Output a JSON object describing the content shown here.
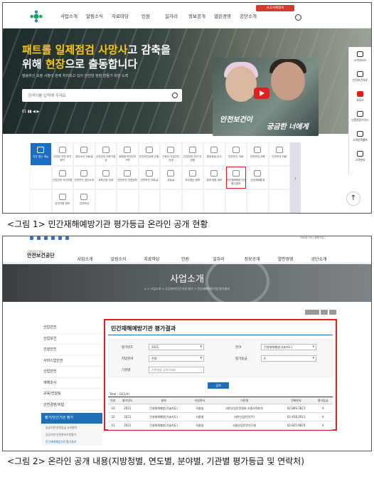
{
  "shot1": {
    "header": {
      "menu": [
        "사업소개",
        "알림소식",
        "자료마당",
        "민원",
        "일자리",
        "정보공개",
        "열린경영",
        "공단소개"
      ],
      "top_button": "사고사례정보"
    },
    "hero": {
      "headline_y1": "패트롤",
      "headline_w1": " 일제점검",
      "headline_y2": " 사망사",
      "headline_w2": "고 감축을",
      "headline_w3": "위해 ",
      "headline_y3": "현장",
      "headline_w4": "으로 출동합니다",
      "sub": "말씀하신 요청 사항이 현재 처리되고 있어 안전한 현장 만들기 위한 노력",
      "search_placeholder": "검색어를 입력해 주세요",
      "pager": "01  ▮▮  ◀ ▶",
      "video_text1": "안전보건이",
      "video_text2": "궁금한 너에게"
    },
    "side_menu": [
      "고객서비스",
      "안전보건자료",
      "유튜브",
      "인증현장가이드",
      "고객만족헬프",
      "고객센터"
    ],
    "grid_items": [
      "자주 찾는 메뉴",
      "사업장 안전 보건평가",
      "공단소식 자료실",
      "산업안전 전문가양성",
      "위험한 작업관리 구역",
      "안전보건교육 신청",
      "근로자 건강진단 안내",
      "산업안전 보건 관련법",
      "현장점검 신고",
      "안전보건 자료",
      "안전보건 교육",
      "안전보건 자료",
      "",
      "산업안전 보건지원",
      "안전보건 공단소개",
      "교육신청 안내",
      "안전보건 관련정보",
      "안전보건 자료실",
      "자료실",
      "자주찾는 정보",
      "유해 위험 정보",
      "민간재해예방기관 평가결과",
      "산업재해통계",
      "",
      "",
      "안전지원 정보",
      "안전보건",
      "",
      "",
      "",
      "",
      "",
      "",
      "",
      "",
      ""
    ],
    "caption": "<그림 1> 민간재해예방기관 평가등급 온라인 공개 현황"
  },
  "shot2": {
    "top_links": "PMS로그인 | 회원가입 |",
    "logo": "안전보건공단",
    "logo_sub": "산업안전보건공단",
    "menu": [
      "사업소개",
      "알림소식",
      "자료마당",
      "민원",
      "일자리",
      "정보공개",
      "열린경영",
      "공단소개"
    ],
    "banner_title": "사업소개",
    "breadcrumb": "⌂  >  사업소개  >  공공분야/민간기관 평가  >  민간재해예방기관 평가결과",
    "lnb": [
      "산업안전",
      "산업보건",
      "건설안전",
      "서비스업안전",
      "산업안전",
      "재해조사",
      "교육/컨설팅",
      "안전경영/위험"
    ],
    "lnb_active": "평가/민간기관 평가",
    "lnb_subs": [
      "공공기관 안전등급 소유평가",
      "공공기관 안전관리수준평가",
      "민간재해예방기관 평가결과"
    ],
    "panel_title": "민간재해예방기관 평가결과",
    "form": {
      "year_label": "평가년도",
      "year_value": "2021",
      "field_label": "분야",
      "field_value": "건설재해예방(기술지도)",
      "region_label": "지방관서",
      "region_value": "전체",
      "grade_label": "평가등급",
      "grade_value": "A",
      "name_label": "기관명",
      "name_placeholder": "기관명을 입력하세요",
      "search_button": "검색"
    },
    "total": "Total : 33(1/4)",
    "table": {
      "headers": [
        "번호",
        "평가년도",
        "분야",
        "지방관서",
        "기관명",
        "전화번호",
        "평가등급"
      ],
      "rows": [
        [
          "33",
          "2021",
          "건설재해예방(기술지도)",
          "서울청",
          "대한산업안전협회 서울지역본부",
          "02-869-7873",
          "A"
        ],
        [
          "32",
          "2021",
          "건설재해예방(기술지도)",
          "서울청",
          "대한산업안전(주)",
          "02-458-2013",
          "A"
        ],
        [
          "31",
          "2021",
          "건설재해예방(기술지도)",
          "서울청",
          "서울산업안전연구원",
          "02-825-6874",
          "A"
        ]
      ]
    },
    "caption": "<그림 2> 온라인 공개 내용(지방청별, 연도별, 분야별, 기관별 평가등급 및 연락처)"
  }
}
